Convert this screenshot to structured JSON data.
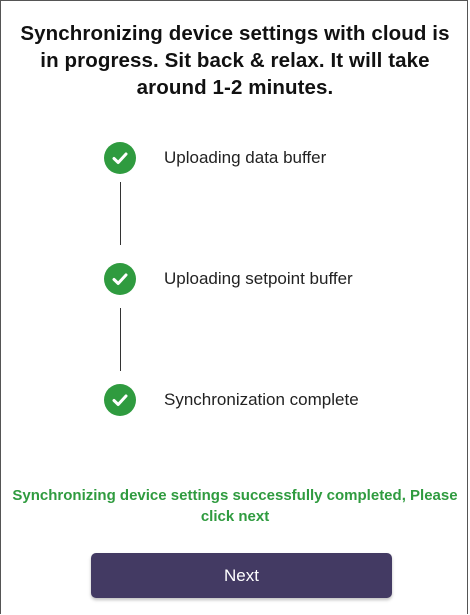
{
  "title": "Synchronizing device settings with cloud is in progress. Sit back & relax. It will take around 1-2 minutes.",
  "steps": [
    {
      "label": "Uploading data buffer",
      "status": "complete",
      "icon": "check-circle-icon"
    },
    {
      "label": "Uploading setpoint buffer",
      "status": "complete",
      "icon": "check-circle-icon"
    },
    {
      "label": "Synchronization complete",
      "status": "complete",
      "icon": "check-circle-icon"
    }
  ],
  "success_message": "Synchronizing device settings successfully completed, Please click next",
  "next_button": {
    "label": "Next"
  },
  "colors": {
    "success_green": "#2f9b3f",
    "button_bg": "#433a63",
    "button_text": "#ffffff"
  }
}
